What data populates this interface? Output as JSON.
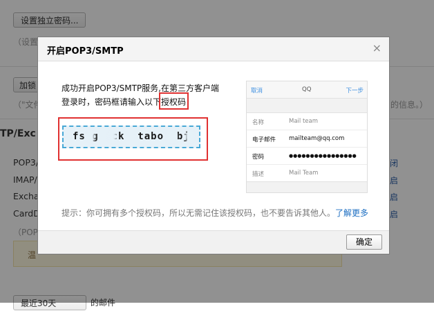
{
  "background": {
    "btn_independent_password": "设置独立密码...",
    "note_1": "（设置",
    "btn_add": "加锁",
    "note_2": "（\"文件",
    "note_2_right": "的信息。）",
    "section_title": "TP/Exc",
    "rows": [
      "POP3/",
      "IMAP/",
      "Excha",
      "CardD"
    ],
    "rows_right": [
      "闭",
      "启",
      "启",
      "启"
    ],
    "pop3_note": "（POP3",
    "warn_text": "温",
    "bottom_select": "最近30天",
    "bottom_text": "的邮件"
  },
  "dialog": {
    "title": "开启POP3/SMTP",
    "close_icon": "×",
    "desc_line1": "成功开启POP3/SMTP服务,在第三方客户端",
    "desc_line2_prefix": "登录时，密码框请输入以下",
    "desc_line2_highlight": "授权码",
    "auth_code": "fs g  ck  tabo  bj",
    "tip_text": "提示：你可拥有多个授权码，所以无需记住该授权码，也不要告诉其他人。",
    "tip_link": "了解更多",
    "ok_label": "确定"
  },
  "phone": {
    "cancel": "取消",
    "title": "QQ",
    "next": "下一步",
    "rows": [
      {
        "key": "名称",
        "value": "Mail team",
        "bold": false
      },
      {
        "key": "电子邮件",
        "value": "mailteam@qq.com",
        "bold": true
      },
      {
        "key": "密码",
        "value": "●●●●●●●●●●●●●●●●",
        "bold": true
      },
      {
        "key": "描述",
        "value": "Mail Team",
        "bold": false
      }
    ]
  }
}
